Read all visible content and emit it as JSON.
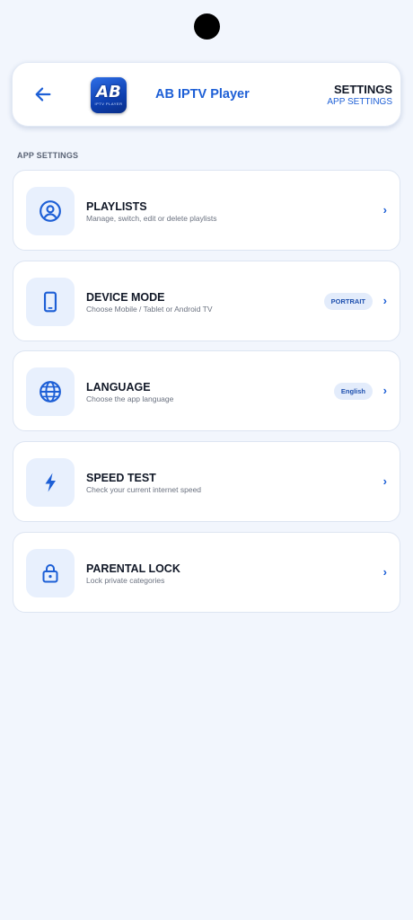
{
  "header": {
    "back_icon": "arrow-left-icon",
    "logo_text": "AB",
    "logo_subtext": "IPTV PLAYER",
    "app_name": "AB IPTV Player",
    "title": "SETTINGS",
    "subtitle": "APP SETTINGS"
  },
  "section_label": "APP SETTINGS",
  "items": [
    {
      "title": "PLAYLISTS",
      "description": "Manage, switch, edit or delete playlists",
      "icon": "user-circle-icon",
      "badge": ""
    },
    {
      "title": "DEVICE MODE",
      "description": "Choose Mobile / Tablet or Android TV",
      "icon": "smartphone-icon",
      "badge": "PORTRAIT"
    },
    {
      "title": "LANGUAGE",
      "description": "Choose the app language",
      "icon": "globe-icon",
      "badge": "English"
    },
    {
      "title": "SPEED TEST",
      "description": "Check your current internet speed",
      "icon": "lightning-bolt-icon",
      "badge": ""
    },
    {
      "title": "PARENTAL LOCK",
      "description": "Lock private categories",
      "icon": "lock-icon",
      "badge": ""
    }
  ],
  "chevron": "›",
  "colors": {
    "accent": "#1d5fd6",
    "background": "#f2f6fd",
    "icon_bg": "#e8f0fd"
  }
}
